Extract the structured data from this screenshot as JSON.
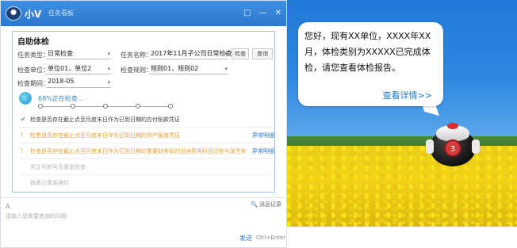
{
  "titlebar": {
    "app_name": "小V",
    "task_tab": "任务看板",
    "controls": [
      "□",
      "—",
      "✕"
    ]
  },
  "panel": {
    "title": "自助体检",
    "task_type": {
      "label": "任务类型：",
      "value": "日常检查"
    },
    "task_name": {
      "label": "任务名称：",
      "value": "2017年11月子公司日常检查"
    },
    "check_button": "检查",
    "query_button": "查询",
    "check_unit": {
      "label": "检查单位：",
      "value": "单位01，单位2"
    },
    "check_rule": {
      "label": "检查规则：",
      "value": "规则01，规则02"
    },
    "check_period": {
      "label": "检查期间：",
      "value": "2018-05"
    },
    "progress": {
      "text": "68%正在检查...",
      "percent": 68,
      "steps": 5
    },
    "results": [
      {
        "status": "ok",
        "mark": "✔",
        "text": "检查是否存在截止点至月度末日作为已到日期的应付账款凭证",
        "link": ""
      },
      {
        "status": "warn",
        "mark": "!",
        "text": "检查是否存在截止点至月度末日作为已到日期的资产报废凭证",
        "link": "异常明细"
      },
      {
        "status": "warn",
        "mark": "!",
        "text": "检查是否存在截止点至月度末日作为已到日期的重要财务账的出纳费用科目过账与发生额的凭证",
        "link": "异常明细"
      },
      {
        "status": "dim",
        "mark": "",
        "text": "凭证号断号及重复检查",
        "link": ""
      },
      {
        "status": "dim",
        "mark": "",
        "text": "报表计算准确性",
        "link": ""
      }
    ]
  },
  "input": {
    "at_icon": "A",
    "placeholder": "请输入您需要查询的问题",
    "message_record": "消息记录",
    "send": "发送",
    "send_hint": "Ctrl+Enter"
  },
  "notice": {
    "text": "您好，现有XX单位，XXXX年XX月，体检类别为XXXXX已完成体检，请您查看体检报告。",
    "link": "查看详情>>",
    "badge": "3"
  },
  "colors": {
    "accent": "#2b78d0",
    "warning": "#e8a13a",
    "ok": "#44a850",
    "link": "#1e77d5"
  }
}
